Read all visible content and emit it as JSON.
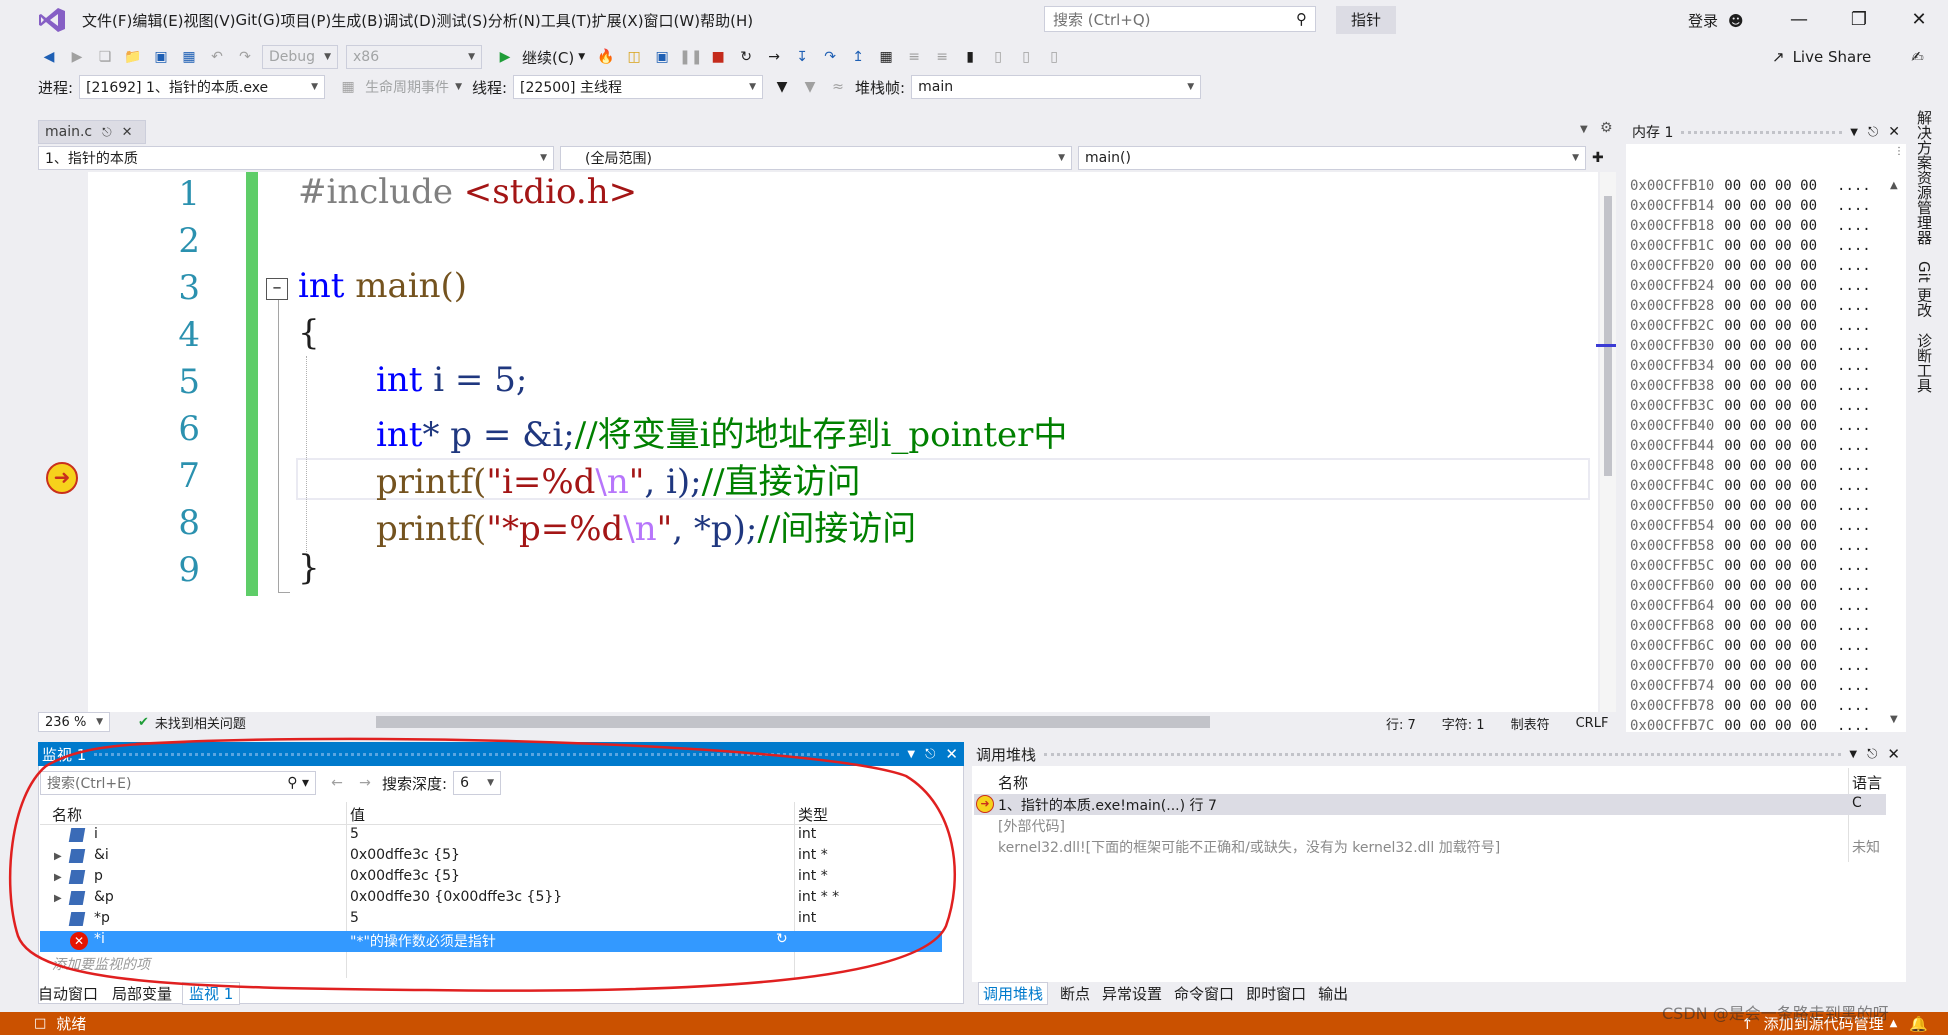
{
  "menubar": {
    "items": [
      "文件(F)",
      "编辑(E)",
      "视图(V)",
      "Git(G)",
      "项目(P)",
      "生成(B)",
      "调试(D)",
      "测试(S)",
      "分析(N)",
      "工具(T)",
      "扩展(X)",
      "窗口(W)",
      "帮助(H)"
    ],
    "search_placeholder": "搜索 (Ctrl+Q)",
    "solution_name": "指针",
    "login": "登录"
  },
  "toolbar1": {
    "config": "Debug",
    "platform": "x86",
    "continue_label": "继续(C)",
    "live_share": "Live Share"
  },
  "toolbar2": {
    "process_label": "进程:",
    "process_value": "[21692] 1、指针的本质.exe",
    "lifecycle_label": "生命周期事件",
    "thread_label": "线程:",
    "thread_value": "[22500] 主线程",
    "stackframe_label": "堆栈帧:",
    "stackframe_value": "main"
  },
  "document": {
    "tab_name": "main.c",
    "nav_project": "1、指针的本质",
    "nav_scope": "(全局范围)",
    "nav_function": "main()"
  },
  "code": {
    "line_numbers": [
      "1",
      "2",
      "3",
      "4",
      "5",
      "6",
      "7",
      "8",
      "9"
    ],
    "l1_directive": "#include",
    "l1_header": "<stdio.h>",
    "l3_kw": "int",
    "l3_rest": " main()",
    "l4": "{",
    "l5_kw": "int",
    "l5_rest": " i = 5;",
    "l6_kw": "int",
    "l6_mid": "* p = &i;",
    "l6_cmt": "//将变量i的地址存到i_pointer中",
    "l7_fn": "printf(",
    "l7_str1": "\"i=%d",
    "l7_esc": "\\n",
    "l7_str2": "\"",
    "l7_rest": ", i);",
    "l7_cmt": "//直接访问",
    "l8_fn": "printf(",
    "l8_str1": "\"*p=%d",
    "l8_esc": "\\n",
    "l8_str2": "\"",
    "l8_rest": ", *p);",
    "l8_cmt": "//间接访问",
    "l9": "}"
  },
  "editor_status": {
    "zoom": "236 %",
    "issues": "未找到相关问题",
    "line": "行: 7",
    "col": "字符: 1",
    "tabs": "制表符",
    "eol": "CRLF"
  },
  "memory": {
    "title": "内存 1",
    "rows": [
      {
        "addr": "0x00CFFB10",
        "bytes": "00 00 00 00",
        "ascii": "...."
      },
      {
        "addr": "0x00CFFB14",
        "bytes": "00 00 00 00",
        "ascii": "...."
      },
      {
        "addr": "0x00CFFB18",
        "bytes": "00 00 00 00",
        "ascii": "...."
      },
      {
        "addr": "0x00CFFB1C",
        "bytes": "00 00 00 00",
        "ascii": "...."
      },
      {
        "addr": "0x00CFFB20",
        "bytes": "00 00 00 00",
        "ascii": "...."
      },
      {
        "addr": "0x00CFFB24",
        "bytes": "00 00 00 00",
        "ascii": "...."
      },
      {
        "addr": "0x00CFFB28",
        "bytes": "00 00 00 00",
        "ascii": "...."
      },
      {
        "addr": "0x00CFFB2C",
        "bytes": "00 00 00 00",
        "ascii": "...."
      },
      {
        "addr": "0x00CFFB30",
        "bytes": "00 00 00 00",
        "ascii": "...."
      },
      {
        "addr": "0x00CFFB34",
        "bytes": "00 00 00 00",
        "ascii": "...."
      },
      {
        "addr": "0x00CFFB38",
        "bytes": "00 00 00 00",
        "ascii": "...."
      },
      {
        "addr": "0x00CFFB3C",
        "bytes": "00 00 00 00",
        "ascii": "...."
      },
      {
        "addr": "0x00CFFB40",
        "bytes": "00 00 00 00",
        "ascii": "...."
      },
      {
        "addr": "0x00CFFB44",
        "bytes": "00 00 00 00",
        "ascii": "...."
      },
      {
        "addr": "0x00CFFB48",
        "bytes": "00 00 00 00",
        "ascii": "...."
      },
      {
        "addr": "0x00CFFB4C",
        "bytes": "00 00 00 00",
        "ascii": "...."
      },
      {
        "addr": "0x00CFFB50",
        "bytes": "00 00 00 00",
        "ascii": "...."
      },
      {
        "addr": "0x00CFFB54",
        "bytes": "00 00 00 00",
        "ascii": "...."
      },
      {
        "addr": "0x00CFFB58",
        "bytes": "00 00 00 00",
        "ascii": "...."
      },
      {
        "addr": "0x00CFFB5C",
        "bytes": "00 00 00 00",
        "ascii": "...."
      },
      {
        "addr": "0x00CFFB60",
        "bytes": "00 00 00 00",
        "ascii": "...."
      },
      {
        "addr": "0x00CFFB64",
        "bytes": "00 00 00 00",
        "ascii": "...."
      },
      {
        "addr": "0x00CFFB68",
        "bytes": "00 00 00 00",
        "ascii": "...."
      },
      {
        "addr": "0x00CFFB6C",
        "bytes": "00 00 00 00",
        "ascii": "...."
      },
      {
        "addr": "0x00CFFB70",
        "bytes": "00 00 00 00",
        "ascii": "...."
      },
      {
        "addr": "0x00CFFB74",
        "bytes": "00 00 00 00",
        "ascii": "...."
      },
      {
        "addr": "0x00CFFB78",
        "bytes": "00 00 00 00",
        "ascii": "...."
      },
      {
        "addr": "0x00CFFB7C",
        "bytes": "00 00 00 00",
        "ascii": "...."
      }
    ]
  },
  "right_tabs": [
    "解决方案资源管理器",
    "Git 更改",
    "诊断工具"
  ],
  "watch": {
    "title": "监视 1",
    "search_placeholder": "搜索(Ctrl+E)",
    "depth_label": "搜索深度:",
    "depth_value": "6",
    "col_name": "名称",
    "col_value": "值",
    "col_type": "类型",
    "rows": [
      {
        "name": "i",
        "value": "5",
        "type": "int"
      },
      {
        "name": "&i",
        "value": "0x00dffe3c {5}",
        "type": "int *"
      },
      {
        "name": "p",
        "value": "0x00dffe3c {5}",
        "type": "int *"
      },
      {
        "name": "&p",
        "value": "0x00dffe30 {0x00dffe3c {5}}",
        "type": "int * *"
      },
      {
        "name": "*p",
        "value": "5",
        "type": "int"
      }
    ],
    "error_row": {
      "name": "*i",
      "value": "\"*\"的操作数必须是指针",
      "type": ""
    },
    "add_hint": "添加要监视的项",
    "tabs": [
      "自动窗口",
      "局部变量",
      "监视 1"
    ]
  },
  "callstack": {
    "title": "调用堆栈",
    "col_name": "名称",
    "col_lang": "语言",
    "rows": [
      {
        "name": "1、指针的本质.exe!main(...) 行 7",
        "lang": "C"
      },
      {
        "name": "[外部代码]",
        "lang": ""
      },
      {
        "name": "kernel32.dll![下面的框架可能不正确和/或缺失，没有为 kernel32.dll 加载符号]",
        "lang": "未知"
      }
    ],
    "tabs": [
      "调用堆栈",
      "断点",
      "异常设置",
      "命令窗口",
      "即时窗口",
      "输出"
    ]
  },
  "statusbar": {
    "ready": "就绪",
    "source_control": "添加到源代码管理",
    "watermark": "CSDN @是会一条路走到黑的呀"
  },
  "colors": {
    "accent": "#007acc",
    "status": "#ca5100",
    "annotation": "#e02020"
  }
}
